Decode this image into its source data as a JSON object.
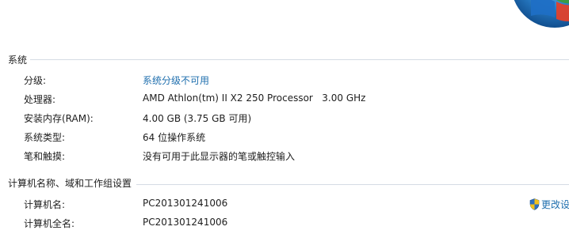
{
  "system_section": {
    "title": "系统",
    "rows": [
      {
        "label": "分级:",
        "value": "系统分级不可用"
      },
      {
        "label": "处理器:",
        "value": "AMD Athlon(tm) II X2 250 Processor   3.00 GHz"
      },
      {
        "label": "安装内存(RAM):",
        "value": "4.00 GB (3.75 GB 可用)"
      },
      {
        "label": "系统类型:",
        "value": "64 位操作系统"
      },
      {
        "label": "笔和触摸:",
        "value": "没有可用于此显示器的笔或触控输入"
      }
    ]
  },
  "computer_section": {
    "title": "计算机名称、域和工作组设置",
    "change_settings_label": "更改设",
    "rows": [
      {
        "label": "计算机名:",
        "value": "PC201301241006"
      },
      {
        "label": "计算机全名:",
        "value": "PC201301241006"
      }
    ]
  },
  "colors": {
    "link": "#1f6fae",
    "text": "#1e1e1e",
    "divider": "#d5dbe4"
  }
}
